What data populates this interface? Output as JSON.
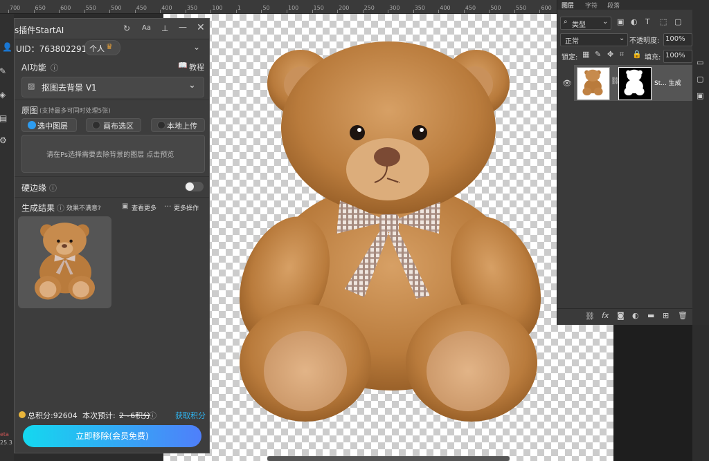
{
  "ruler": {
    "labels": [
      "700",
      "650",
      "600",
      "550",
      "500",
      "450",
      "400",
      "350",
      "100",
      "1",
      "50",
      "100",
      "150",
      "200",
      "250",
      "300",
      "350",
      "400",
      "450",
      "500",
      "550",
      "600"
    ]
  },
  "plugin": {
    "title": "s插件StartAI",
    "uid_text": "UID：763802291",
    "account_badge": "个人",
    "ai_section_label": "AI功能",
    "tutorial_label": "教程",
    "ai_feature_dropdown": "抠图去背景 V1",
    "source_label": "原图",
    "source_hint": "(支持最多可同时处理5张)",
    "source_options": [
      "选中图层",
      "画布选区",
      "本地上传"
    ],
    "source_selected": "选中图层",
    "preview_hint": "请在Ps选择需要去除背景的图层 点击预览",
    "hard_edge_label": "硬边缘",
    "hard_edge_enabled": false,
    "result_label": "生成结果",
    "result_feedback": "效果不满意?",
    "view_more": "查看更多",
    "more_actions": "更多操作",
    "points_total": "总积分:92604",
    "points_estimate_prefix": "本次预计:",
    "points_estimate_value": "2~6积分",
    "get_points": "获取积分",
    "cta_label": "立即移除(会员免费)",
    "accent_color": "#2d9cf0"
  },
  "left_edge": {
    "texts": [
      "eta",
      "25.3"
    ]
  },
  "layers_panel": {
    "tabs": [
      "图层",
      "字符",
      "段落"
    ],
    "active_tab": "图层",
    "filter_kind": "类型",
    "blend_mode": "正常",
    "opacity_label": "不透明度:",
    "opacity_value": "100%",
    "lock_label": "锁定:",
    "fill_label": "填充:",
    "fill_value": "100%",
    "layer_name": "St... 生成"
  }
}
